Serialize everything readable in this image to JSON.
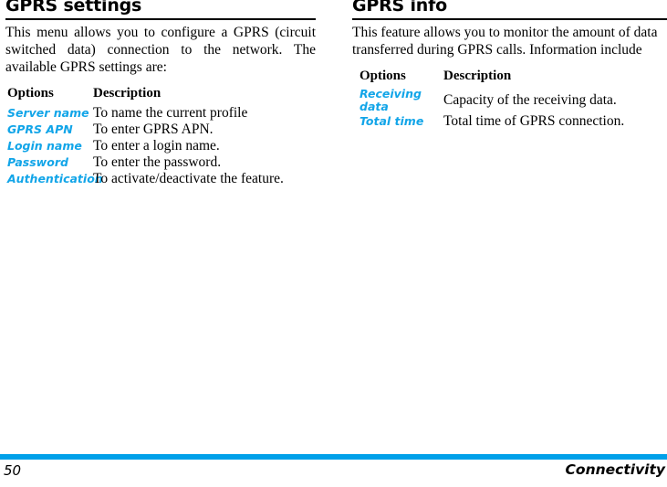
{
  "footer": {
    "page_number": "50",
    "section_label": "Connectivity",
    "rule_color": "#00A0E9"
  },
  "accent_color": "#12A5E8",
  "columns": [
    {
      "id": "gprs-settings",
      "title": "GPRS settings",
      "intro": "This menu allows you to configure a GPRS (circuit switched data) connection to the network. The available GPRS settings are:",
      "table": {
        "headers": {
          "options": "Options",
          "description": "Description"
        },
        "rows": [
          {
            "option": "Server name",
            "description": "To name the current profile"
          },
          {
            "option": "GPRS APN",
            "description": "To enter GPRS APN."
          },
          {
            "option": "Login name",
            "description": "To enter a login name."
          },
          {
            "option": "Password",
            "description": "To enter the password."
          },
          {
            "option": "Authentication",
            "description": "To activate/deactivate the feature."
          }
        ]
      }
    },
    {
      "id": "gprs-info",
      "title": "GPRS info",
      "intro": "This feature allows you to monitor the amount of data transferred during GPRS calls. Information include",
      "table": {
        "headers": {
          "options": "Options",
          "description": "Description"
        },
        "rows": [
          {
            "option": "Receiving data",
            "description": "Capacity of the receiving data."
          },
          {
            "option": "Total time",
            "description": "Total time of GPRS connection."
          }
        ]
      }
    }
  ]
}
